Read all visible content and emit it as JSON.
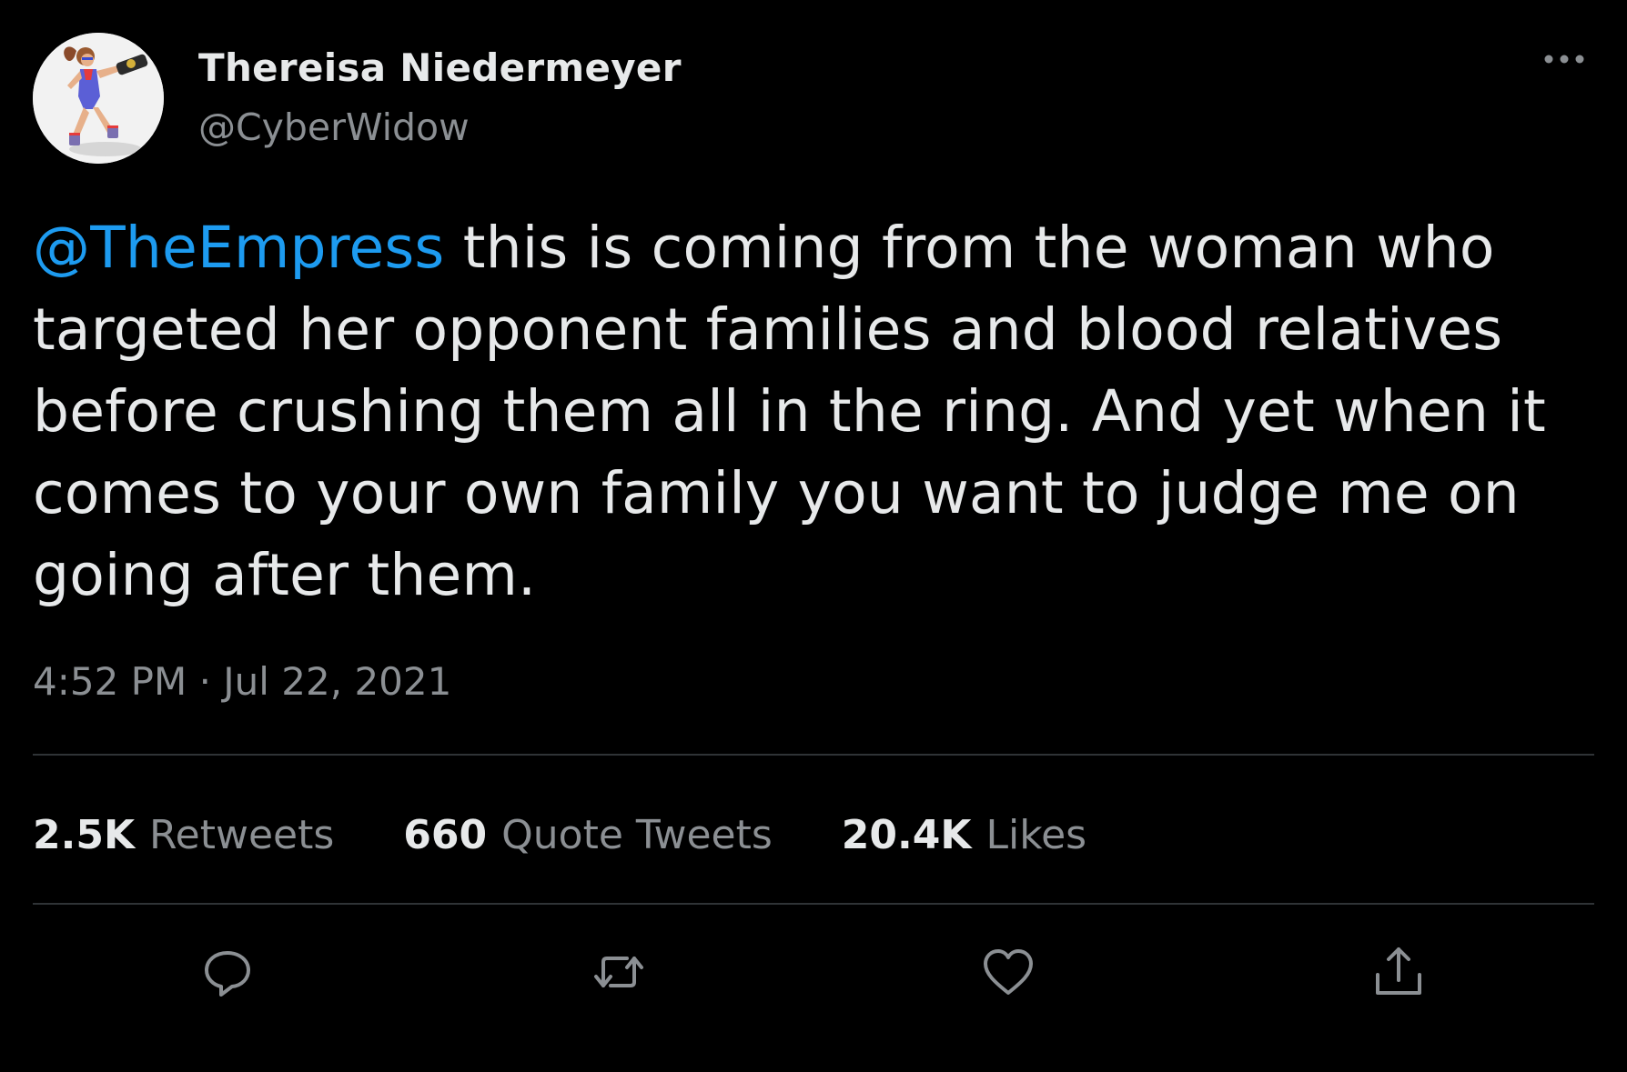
{
  "tweet": {
    "author": {
      "display_name": "Thereisa Niedermeyer",
      "handle": "@CyberWidow",
      "avatar": "avatar-image"
    },
    "mention": "@TheEmpress",
    "text": " this is coming from the woman who targeted her opponent families and blood relatives before crushing them all in the ring. And yet when it comes to your own family you want to judge me on going after them.",
    "timestamp": "4:52 PM · Jul 22, 2021",
    "stats": {
      "retweets_count": "2.5K",
      "retweets_label": "Retweets",
      "quotes_count": "660",
      "quotes_label": "Quote Tweets",
      "likes_count": "20.4K",
      "likes_label": "Likes"
    },
    "actions": [
      "reply-icon",
      "retweet-icon",
      "like-icon",
      "share-icon"
    ],
    "more_icon": "more-dots-icon"
  },
  "colors": {
    "background": "#000000",
    "text": "#e7e9ea",
    "secondary": "#8b8f93",
    "link": "#1d9bf0",
    "divider": "#2f3336"
  }
}
